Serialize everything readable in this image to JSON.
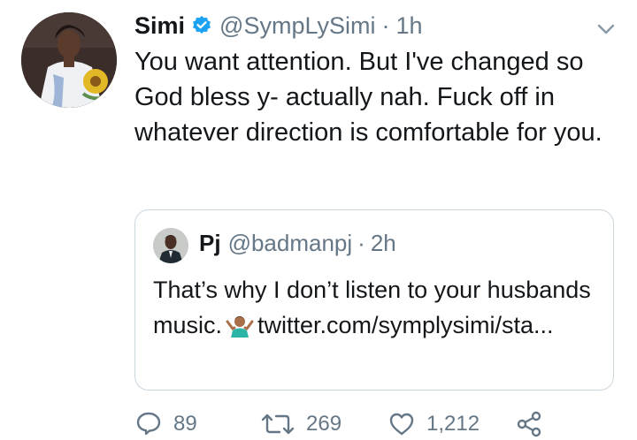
{
  "tweet": {
    "author_name": "Simi",
    "author_handle": "@SympLySimi",
    "separator": "·",
    "time": "1h",
    "text": "You want attention. But I've changed so God bless y- actually nah. Fuck off in whatever direction is comfortable for you."
  },
  "quote": {
    "author_name": "Pj",
    "author_handle": "@badmanpj",
    "separator": "·",
    "time": "2h",
    "text_before_emoji": "That’s why I don’t listen to your husbands music.",
    "emoji_name": "person-shrugging-emoji",
    "text_after_emoji": "twitter.com/symplysimi/sta..."
  },
  "actions": {
    "replies": "89",
    "retweets": "269",
    "likes": "1,212"
  },
  "colors": {
    "text": "#14171a",
    "muted": "#657786",
    "border": "#ccd6dd",
    "verified": "#1da1f2"
  },
  "icons": [
    "verified-badge-icon",
    "chevron-down-icon",
    "reply-icon",
    "retweet-icon",
    "like-icon",
    "share-icon"
  ]
}
